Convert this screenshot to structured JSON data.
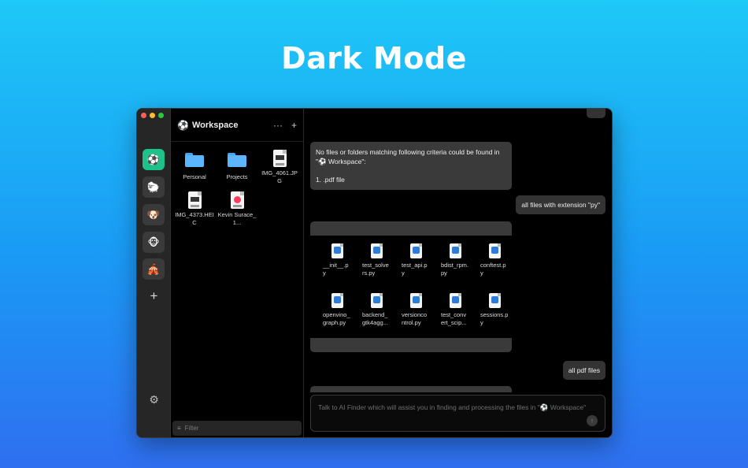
{
  "headline": "Dark Mode",
  "sidebar": {
    "workspaces": [
      {
        "icon": "⚽",
        "name": "workspace-soccer",
        "active": true
      },
      {
        "icon": "🐑",
        "name": "workspace-sheep",
        "active": false
      },
      {
        "icon": "🐶",
        "name": "workspace-dog",
        "active": false
      },
      {
        "icon": "🐵",
        "name": "workspace-monkey",
        "active": false
      },
      {
        "icon": "🎪",
        "name": "workspace-tent",
        "active": false
      }
    ],
    "add_icon": "+",
    "settings_icon": "⚙"
  },
  "files_pane": {
    "workspace_icon": "⚽",
    "title": "Workspace",
    "more_icon": "···",
    "add_icon": "+",
    "items": [
      {
        "label": "Personal",
        "kind": "folder"
      },
      {
        "label": "Projects",
        "kind": "folder"
      },
      {
        "label": "IMG_4061.JPG",
        "kind": "image"
      },
      {
        "label": "IMG_4373.HEIC",
        "kind": "image"
      },
      {
        "label": "Kevin Surace_ 1...",
        "kind": "music"
      }
    ],
    "filter_placeholder": "Filter",
    "filter_icon": "≡"
  },
  "chat": {
    "ai_message_1": {
      "line1": "No files or folders matching following criteria could be found in",
      "line2": "\"⚽ Workspace\":",
      "line3": "1. .pdf file"
    },
    "user_message_1": "all files with extension \"py\"",
    "result_files": [
      "__init__.py",
      "test_solvers.py",
      "test_api.py",
      "bdist_rpm.py",
      "conftest.py",
      "openvino_graph.py",
      "backend_gtk4agg...",
      "versioncontrol.py",
      "test_convert_scip...",
      "sessions.py"
    ],
    "user_message_2": "all pdf files",
    "composer_placeholder": "Talk to AI Finder which will assist you in finding and processing the files in \"⚽ Workspace\"",
    "send_icon": "↑"
  }
}
